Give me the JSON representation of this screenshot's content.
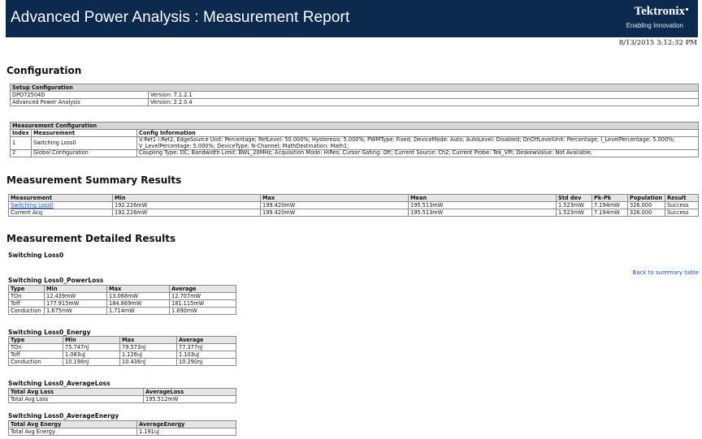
{
  "header": {
    "title": "Advanced Power Analysis : Measurement Report",
    "brand": "Tektronix",
    "tagline": "Enabling Innovation",
    "timestamp": "8/13/2015 3:12:32 PM"
  },
  "configuration": {
    "heading": "Configuration",
    "setup": {
      "caption": "Setup Configuration",
      "rows": [
        [
          "DPO72504D",
          "Version: 7.1.2.1"
        ],
        [
          "Advanced Power Analysis",
          "Version: 2.2.0.4"
        ]
      ]
    },
    "measurement": {
      "caption": "Measurement Configuration",
      "headers": [
        "Index",
        "Measurement",
        "Config Information"
      ],
      "rows": [
        [
          "1",
          "Switching Loss0",
          "V:Ref1 I:Ref2; EdgeSource Unit: Percentage; RefLevel: 50.000%; Hysteresis: 5.000%; PWMType: Fixed; DeviceMode: Auto; AutoLevel: Disabled; OnOffLevelUnit: Percentage; I_LevelPercentage: 5.000%; V_LevelPercentage: 5.000%; DeviceType: N-Channel; MathDestination: Math1;"
        ],
        [
          "2",
          "Global Configuration",
          "Coupling Type: DC; Bandwidth Limit: BWL_20MHz; Acquisition Mode: HiRes; Cursor Gating: Off; Current Source: Ch2; Current Probe: Tek_VPI; DeskewValue: Not Available;"
        ]
      ]
    }
  },
  "summary": {
    "heading": "Measurement Summary Results",
    "headers": [
      "Measurement",
      "Min",
      "Max",
      "Mean",
      "Std dev",
      "Pk-Pk",
      "Population",
      "Result"
    ],
    "rows": [
      [
        "Switching Loss0",
        "192.226mW",
        "199.420mW",
        "195.513mW",
        "1.523mW",
        "7.194mW",
        "326.000",
        "Success"
      ],
      [
        "Current Acq",
        "192.226mW",
        "199.420mW",
        "195.513mW",
        "1.523mW",
        "7.194mW",
        "326.000",
        "Success"
      ]
    ]
  },
  "detailed": {
    "heading": "Measurement Detailed Results",
    "subheading": "Switching Loss0",
    "back_link": "Back to summary table",
    "power_loss": {
      "caption": "Switching Loss0_PowerLoss",
      "headers": [
        "Type",
        "Min",
        "Max",
        "Average"
      ],
      "rows": [
        [
          "TOn",
          "12.439mW",
          "13.068mW",
          "12.707mW"
        ],
        [
          "Toff",
          "177.915mW",
          "184.869mW",
          "181.115mW"
        ],
        [
          "Conduction",
          "1.675mW",
          "1.714mW",
          "1.690mW"
        ]
      ]
    },
    "energy": {
      "caption": "Switching Loss0_Energy",
      "headers": [
        "Type",
        "Min",
        "Max",
        "Average"
      ],
      "rows": [
        [
          "TOn",
          "75.747nJ",
          "79.573nJ",
          "77.377nJ"
        ],
        [
          "Toff",
          "1.083uJ",
          "1.126uJ",
          "1.103uJ"
        ],
        [
          "Conduction",
          "10.198nJ",
          "10.436nJ",
          "10.290nJ"
        ]
      ]
    },
    "avg_loss": {
      "caption": "Switching Loss0_AverageLoss",
      "headers": [
        "Total Avg Loss",
        "AverageLoss"
      ],
      "rows": [
        [
          "Total Avg Loss",
          "195.512mW"
        ]
      ]
    },
    "avg_energy": {
      "caption": "Switching Loss0_AverageEnergy",
      "headers": [
        "Total Avg Energy",
        "AverageEnergy"
      ],
      "rows": [
        [
          "Total Avg Energy",
          "1.191uJ"
        ]
      ]
    }
  }
}
